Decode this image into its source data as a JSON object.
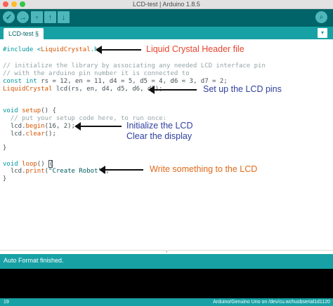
{
  "window": {
    "title": "LCD-test | Arduino 1.8.5"
  },
  "toolbar": {
    "verify_glyph": "✓",
    "upload_glyph": "→",
    "new_glyph": "▫",
    "open_glyph": "↑",
    "save_glyph": "↓",
    "serial_glyph": "⌕"
  },
  "tabs": {
    "active": "LCD-test §",
    "menu_glyph": "▾"
  },
  "code": {
    "l1_pre": "#include <",
    "l1_lib": "LiquidCrystal",
    "l1_post": ".h>",
    "l2": "// initialize the library by associating any needed LCD interface pin",
    "l3": "// with the arduino pin number it is connected to",
    "l4_kw1": "const",
    "l4_kw2": "int",
    "l4_rest": " rs = 12, en = 11, d4 = 5, d5 = 4, d6 = 3, d7 = 2;",
    "l5_type": "LiquidCrystal",
    "l5_rest": " lcd(rs, en, d4, d5, d6, d7);",
    "l6_kw": "void",
    "l6_fn": "setup",
    "l6_rest": "() {",
    "l7": "  // put your setup code here, to run once:",
    "l8_pre": "  lcd.",
    "l8_fn": "begin",
    "l8_rest": "(16, 2);",
    "l9_pre": "  lcd.",
    "l9_fn": "clear",
    "l9_rest": "();",
    "l10": "}",
    "l11_kw": "void",
    "l11_fn": "loop",
    "l11_rest": "() ",
    "l11_brace": "{",
    "l12_pre": "  lcd.",
    "l12_fn": "print",
    "l12_open": "(",
    "l12_str": "\"Create Robot\"",
    "l12_close": ");",
    "l13": "}"
  },
  "annotations": {
    "header": "Liquid Crystal Header file",
    "pins": "Set up the LCD pins",
    "init_1": "Initialize the LCD",
    "init_2": "Clear the display",
    "write": "Write something to the LCD",
    "color_red": "#e8442e",
    "color_blue": "#2f3f9e",
    "color_orange": "#e06a1b"
  },
  "status": {
    "message": "Auto Format finished."
  },
  "footer": {
    "line": "19",
    "board": "Arduino/Genuino Uno on /dev/cu.wchusbserial1d1120"
  },
  "colors": {
    "toolbar": "#006468",
    "tabbar": "#17a1a5",
    "button": "#4db7bb"
  }
}
